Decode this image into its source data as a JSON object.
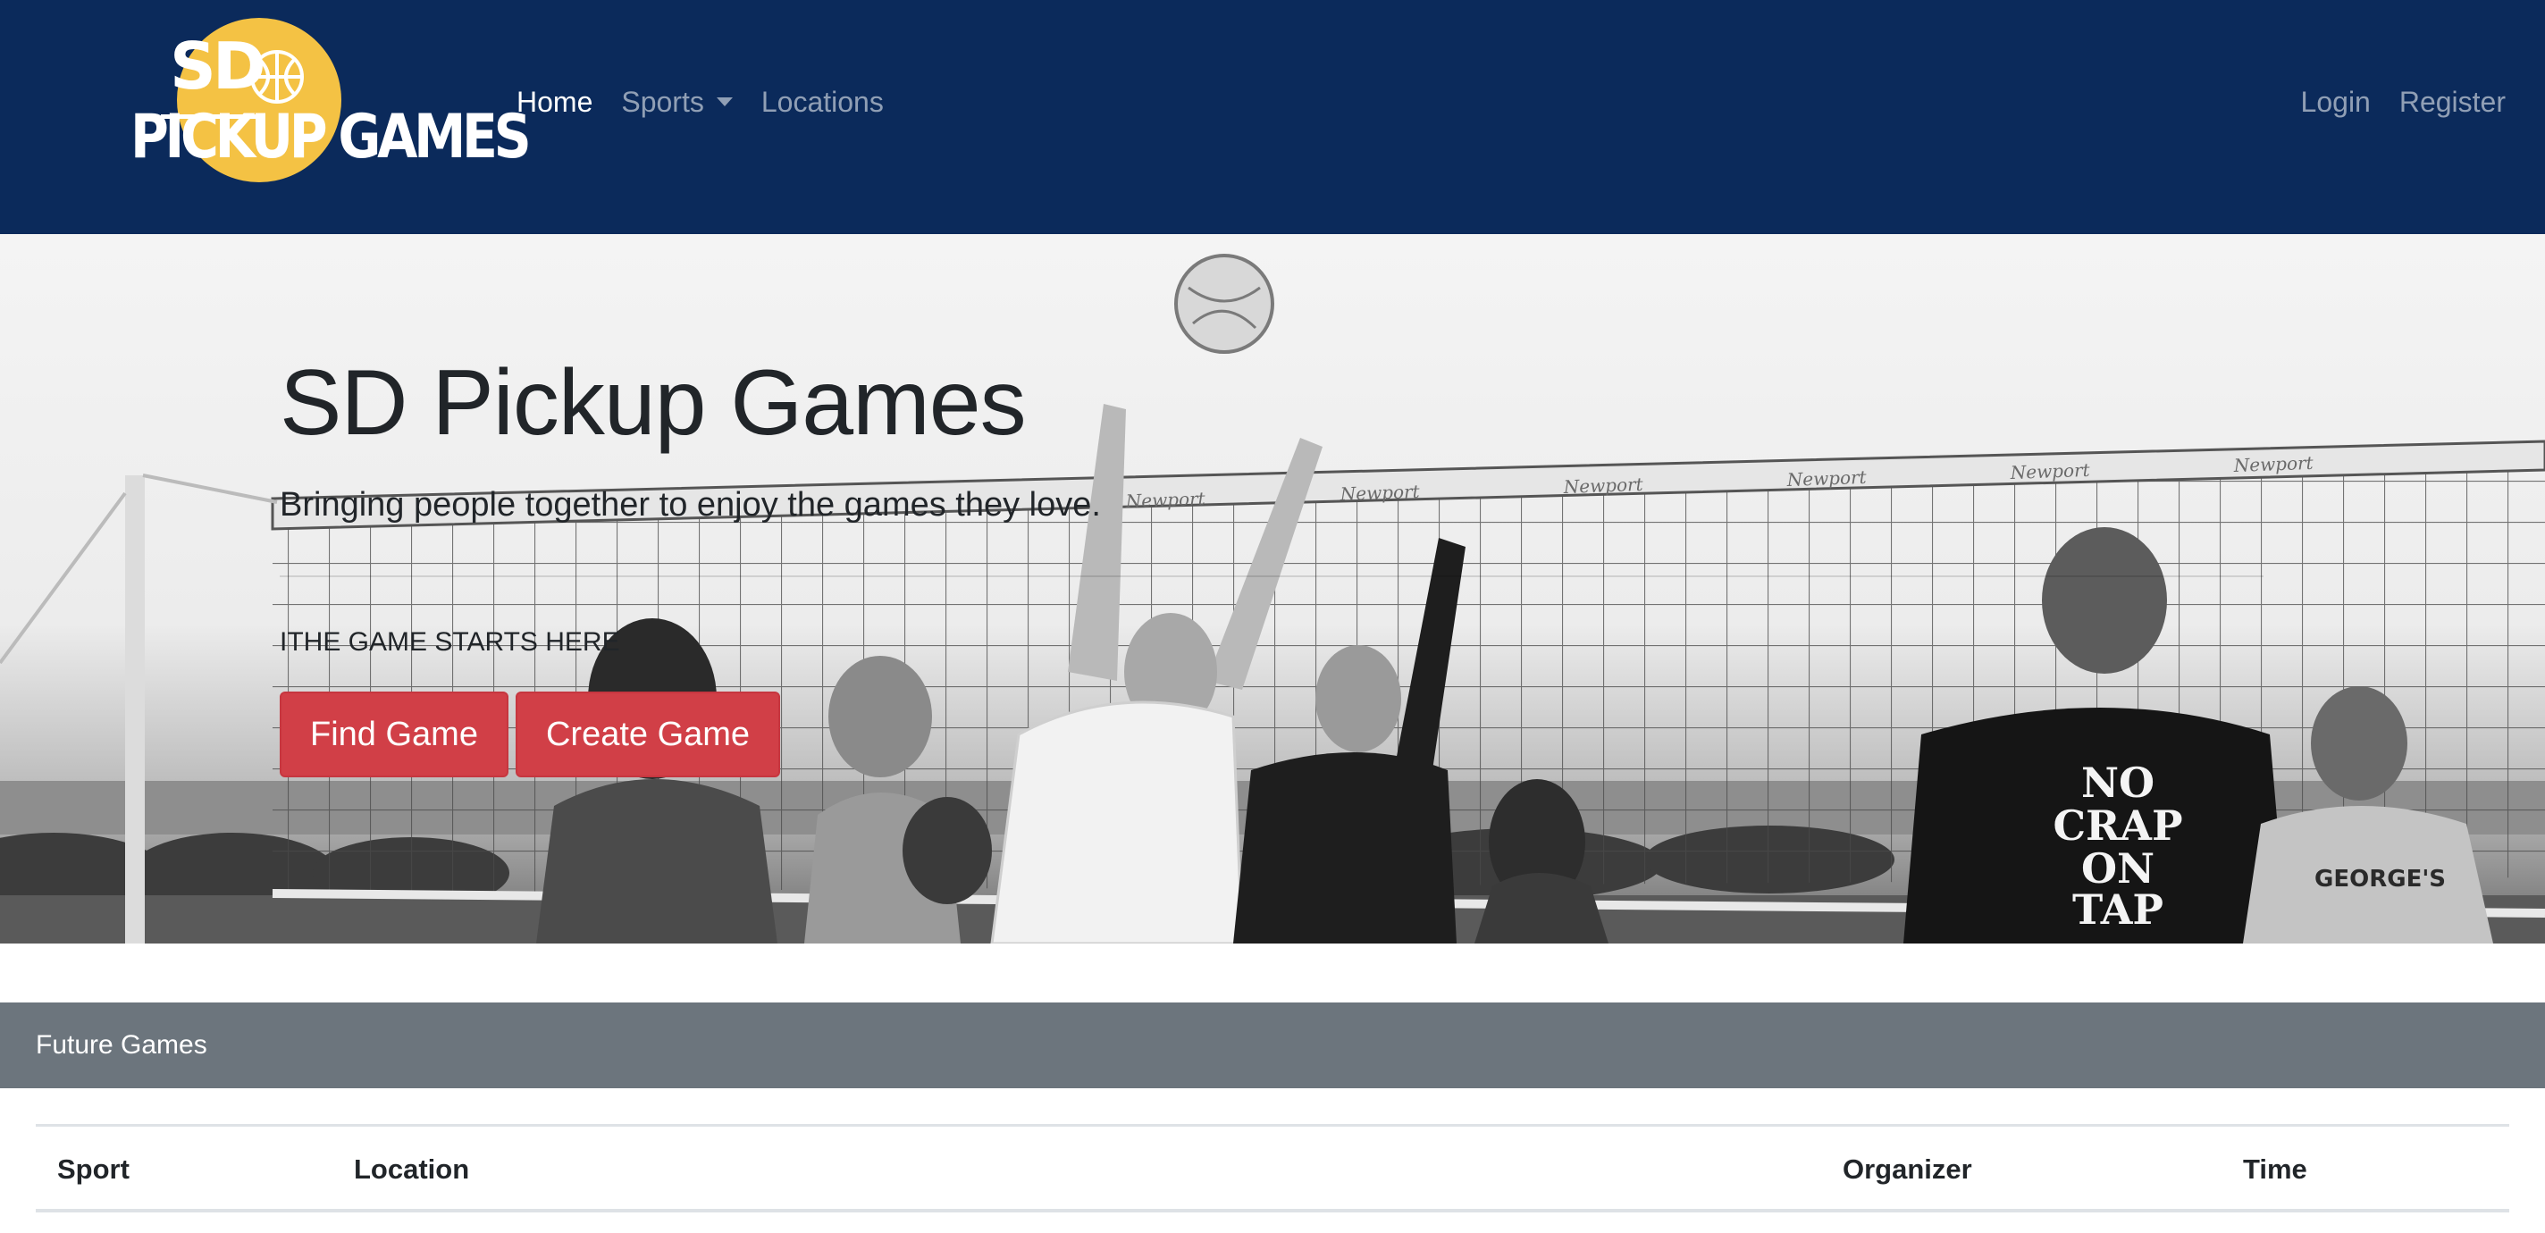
{
  "brand": {
    "line1": "SD",
    "line2": "PICKUP GAMES",
    "colors": {
      "circle": "#f4c244",
      "navbar": "#0b2a5b"
    }
  },
  "nav": {
    "items": [
      {
        "label": "Home",
        "active": true
      },
      {
        "label": "Sports",
        "dropdown": true
      },
      {
        "label": "Locations"
      }
    ],
    "right": [
      {
        "label": "Login"
      },
      {
        "label": "Register"
      }
    ]
  },
  "hero": {
    "title": "SD Pickup Games",
    "lead": "Bringing people together to enjoy the games they love.",
    "tagline": "ITHE GAME STARTS HERE",
    "buttons": {
      "find": "Find Game",
      "create": "Create Game"
    },
    "shirt_text": [
      "NO",
      "CRAP",
      "ON",
      "TAP"
    ],
    "shirt_text_2": "GEORGE'S",
    "net_brand": "Newport"
  },
  "future_games": {
    "header": "Future Games",
    "columns": [
      "Sport",
      "Location",
      "Organizer",
      "Time"
    ],
    "rows": []
  },
  "colors": {
    "danger": "#d13f47",
    "card_header": "#6c757d"
  }
}
